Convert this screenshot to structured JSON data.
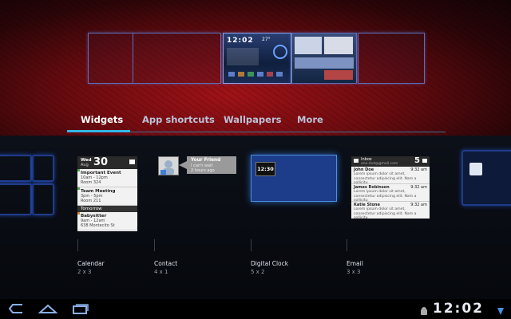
{
  "home_screens": {
    "mini_clock": "12:02",
    "mini_temp": "27°"
  },
  "tabs": [
    {
      "label": "Widgets"
    },
    {
      "label": "App shortcuts"
    },
    {
      "label": "Wallpapers"
    },
    {
      "label": "More"
    }
  ],
  "calendar_widget": {
    "dow": "Wed",
    "month": "Aug",
    "day": "30",
    "events": [
      {
        "title": "Important Event",
        "time": "10am - 12pm",
        "place": "Room 324"
      },
      {
        "title": "Team Meeting",
        "time": "3pm - 5pm",
        "place": "Room 211"
      }
    ],
    "tomorrow_label": "Tomorrow",
    "tomorrow_event": {
      "title": "Babysitter",
      "time": "9am - 12am",
      "place": "638 Montecito St"
    }
  },
  "contact_widget": {
    "name": "Your Friend",
    "status": "I can't wait",
    "ago": "2 hours ago"
  },
  "digital_clock_widget": {
    "time": "12:30"
  },
  "email_widget": {
    "folder": "Inbox",
    "account": "one.dvd@gmail.com",
    "count": "5",
    "messages": [
      {
        "from": "John Doe",
        "time": "9:32 am",
        "preview": "Lorem ipsum dolor sit amet, consectetur adipiscing elit. Nam a sollicitu"
      },
      {
        "from": "James Robinson",
        "time": "9:32 am",
        "preview": "Lorem ipsum dolor sit amet, consectetur adipiscing elit. Nam a sollicitu"
      },
      {
        "from": "Katie Stone",
        "time": "9:32 am",
        "preview": "Lorem ipsum dolor sit amet, consectetur adipiscing elit. Nam a sollicitu"
      }
    ]
  },
  "widgets": [
    {
      "name": "Calendar",
      "size": "2 x 3"
    },
    {
      "name": "Contact",
      "size": "4 x 1"
    },
    {
      "name": "Digital Clock",
      "size": "5 x 2"
    },
    {
      "name": "Email",
      "size": "3 x 3"
    }
  ],
  "system_bar": {
    "time": "12:02",
    "buttons": [
      "back-icon",
      "home-icon",
      "recent-apps-icon"
    ],
    "status_icons": [
      "android-debug-icon",
      "wifi-signal-icon"
    ]
  },
  "colors": {
    "accent": "#33b5e5",
    "wallpaper": "#8a1014",
    "selection_glow": "#4a8fe0"
  }
}
